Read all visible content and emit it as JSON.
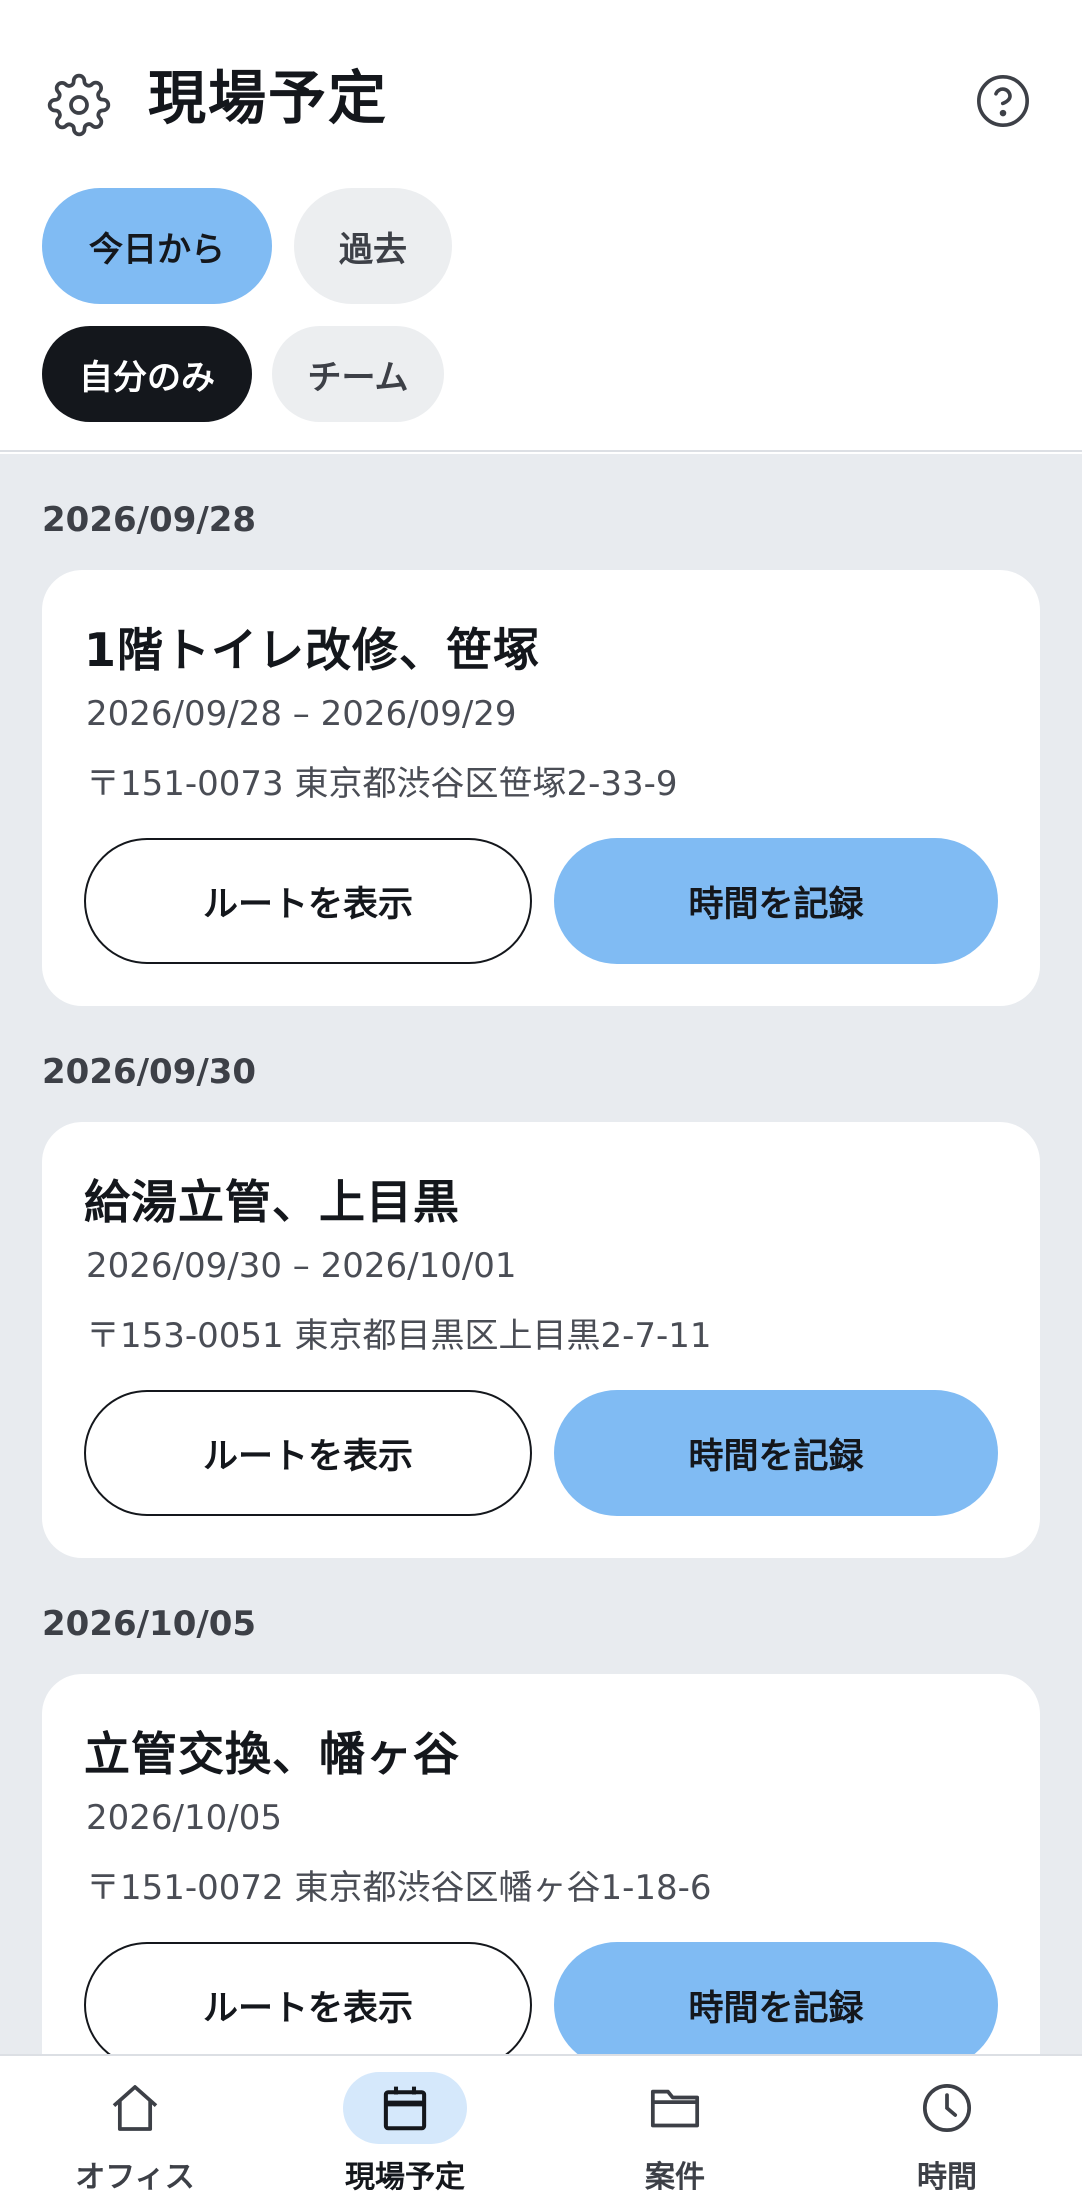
{
  "header": {
    "title": "現場予定",
    "settings_icon": "gear-icon",
    "help_icon": "help-icon"
  },
  "filters": {
    "period": [
      {
        "label": "今日から",
        "selected": true
      },
      {
        "label": "過去",
        "selected": false
      }
    ],
    "scope": [
      {
        "label": "自分のみ",
        "selected": true
      },
      {
        "label": "チーム",
        "selected": false
      }
    ]
  },
  "schedule": [
    {
      "date": "2026/09/28",
      "title": "1階トイレ改修、笹塚",
      "dates": "2026/09/28 – 2026/09/29",
      "address": "〒151-0073 東京都渋谷区笹塚2-33-9",
      "route_label": "ルートを表示",
      "record_label": "時間を記録"
    },
    {
      "date": "2026/09/30",
      "title": "給湯立管、上目黒",
      "dates": "2026/09/30 – 2026/10/01",
      "address": "〒153-0051 東京都目黒区上目黒2-7-11",
      "route_label": "ルートを表示",
      "record_label": "時間を記録"
    },
    {
      "date": "2026/10/05",
      "title": "立管交換、幡ヶ谷",
      "dates": "2026/10/05",
      "address": "〒151-0072 東京都渋谷区幡ヶ谷1-18-6",
      "route_label": "ルートを表示",
      "record_label": "時間を記録"
    }
  ],
  "nav": [
    {
      "label": "オフィス",
      "icon": "home-icon",
      "active": false
    },
    {
      "label": "現場予定",
      "icon": "calendar-icon",
      "active": true
    },
    {
      "label": "案件",
      "icon": "folder-icon",
      "active": false
    },
    {
      "label": "時間",
      "icon": "clock-icon",
      "active": false
    }
  ],
  "colors": {
    "accent": "#80bbf3",
    "accent_light": "#d5e8fb",
    "dark": "#14171c",
    "background": "#e8ebef"
  }
}
